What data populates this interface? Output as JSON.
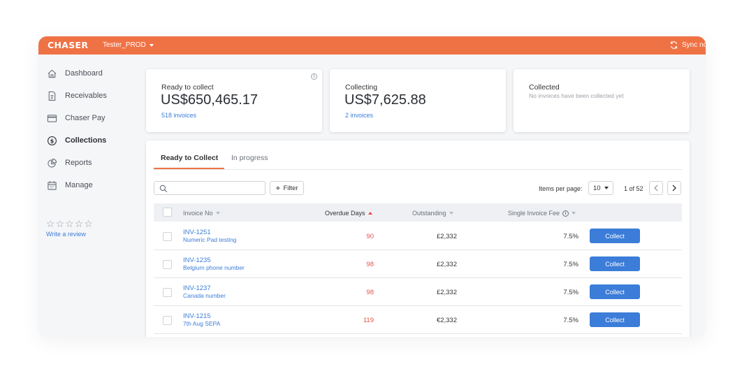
{
  "app": {
    "logo": "CHASER",
    "environment": "Tester_PROD",
    "sync_label": "Sync no"
  },
  "sidebar": {
    "items": [
      {
        "label": "Dashboard",
        "icon": "home-icon"
      },
      {
        "label": "Receivables",
        "icon": "document-icon"
      },
      {
        "label": "Chaser Pay",
        "icon": "credit-card-icon"
      },
      {
        "label": "Collections",
        "icon": "dollar-circle-icon"
      },
      {
        "label": "Reports",
        "icon": "pie-chart-icon"
      },
      {
        "label": "Manage",
        "icon": "calendar-icon"
      }
    ],
    "active": "Collections",
    "rating_stars": 5,
    "review_link": "Write a review"
  },
  "summary": {
    "ready": {
      "title": "Ready to collect",
      "amount": "US$650,465.17",
      "invoices": "518 invoices"
    },
    "collecting": {
      "title": "Collecting",
      "amount": "US$7,625.88",
      "invoices": "2 invoices"
    },
    "collected": {
      "title": "Collected",
      "note": "No invoices have been collected yet"
    }
  },
  "tabs": [
    {
      "label": "Ready to Collect",
      "active": true
    },
    {
      "label": "In progress",
      "active": false
    }
  ],
  "toolbar": {
    "search_placeholder": "",
    "filter_label": "Filter",
    "items_per_page_label": "Items per page:",
    "items_per_page": "10",
    "page_info": "1 of 52"
  },
  "table": {
    "headers": {
      "invoice_no": "Invoice No",
      "overdue_days": "Overdue Days",
      "outstanding": "Outstanding",
      "fee": "Single Invoice Fee"
    },
    "rows": [
      {
        "invoice": "INV-1251",
        "desc": "Numeric Pad testing",
        "days": "90",
        "outstanding": "£2,332",
        "fee": "7.5%",
        "action": "Collect"
      },
      {
        "invoice": "INV-1235",
        "desc": "Belgium phone number",
        "days": "98",
        "outstanding": "£2,332",
        "fee": "7.5%",
        "action": "Collect"
      },
      {
        "invoice": "INV-1237",
        "desc": "Canada number",
        "days": "98",
        "outstanding": "£2,332",
        "fee": "7.5%",
        "action": "Collect"
      },
      {
        "invoice": "INV-1215",
        "desc": "7th Aug SEPA",
        "days": "119",
        "outstanding": "€2,332",
        "fee": "7.5%",
        "action": "Collect"
      }
    ]
  },
  "colors": {
    "brand": "#ef7245",
    "link": "#3b7dd8",
    "overdue": "#e5534b",
    "button": "#3b7dd8"
  }
}
